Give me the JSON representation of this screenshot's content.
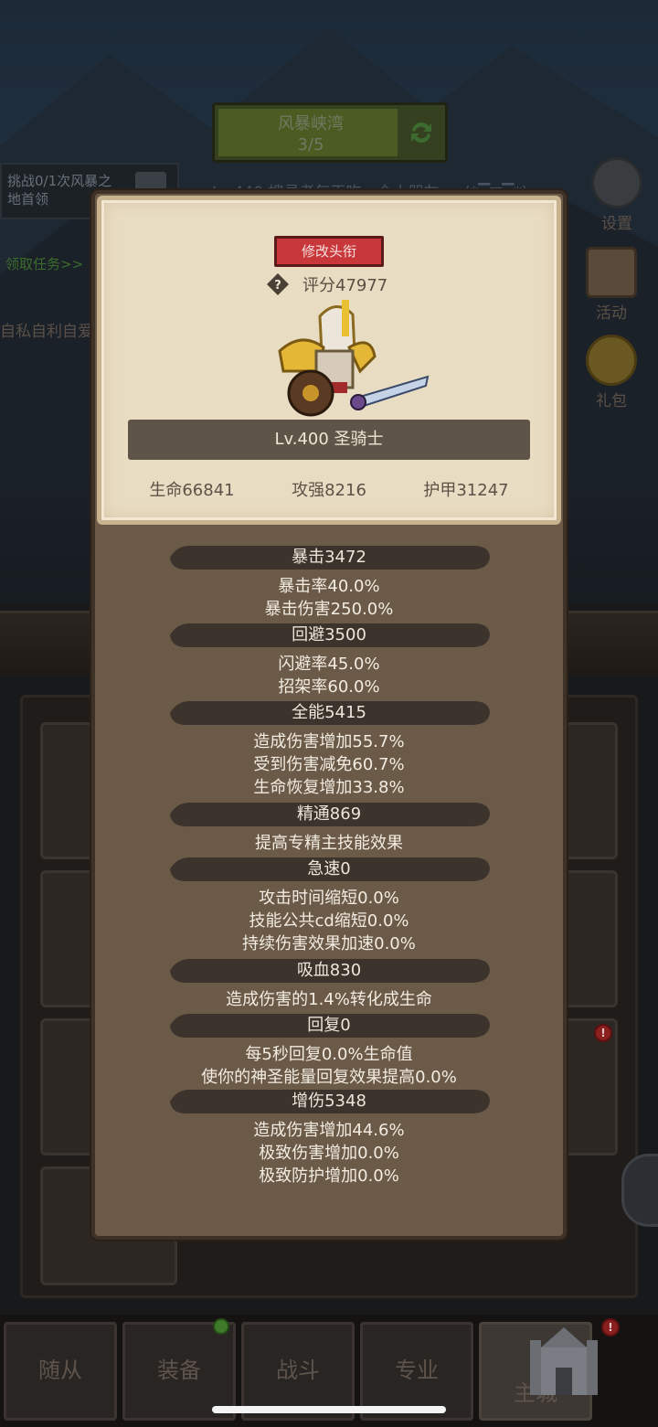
{
  "background": {
    "stage": {
      "name": "风暴峡湾",
      "progress": "3/5"
    },
    "quest": {
      "text": "挑战0/1次风暴之地首领",
      "link": "领取任务>>"
    },
    "chat_line": "自私自利自爱",
    "marquee": "Lv.440 搜寻者每天吃一个小朋友～o(*▔▽▔*)o",
    "side_buttons": [
      {
        "label": "设置",
        "icon": "gear-icon"
      },
      {
        "label": "活动",
        "icon": "scroll-icon"
      },
      {
        "label": "礼包",
        "icon": "gift-pouch-icon"
      }
    ],
    "bottom_nav": [
      "随从",
      "装备",
      "战斗",
      "专业",
      "主城"
    ]
  },
  "modal": {
    "title_button": "修改头衔",
    "score_label": "评分47977",
    "hero_name": "Lv.400 圣骑士",
    "main_stats": {
      "hp": "生命66841",
      "attack": "攻强8216",
      "armor": "护甲31247"
    },
    "sections": [
      {
        "header": "暴击3472",
        "lines": [
          "暴击率40.0%",
          "暴击伤害250.0%"
        ]
      },
      {
        "header": "回避3500",
        "lines": [
          "闪避率45.0%",
          "招架率60.0%"
        ]
      },
      {
        "header": "全能5415",
        "lines": [
          "造成伤害增加55.7%",
          "受到伤害减免60.7%",
          "生命恢复增加33.8%"
        ]
      },
      {
        "header": "精通869",
        "lines": [
          "提高专精主技能效果"
        ]
      },
      {
        "header": "急速0",
        "lines": [
          "攻击时间缩短0.0%",
          "技能公共cd缩短0.0%",
          "持续伤害效果加速0.0%"
        ]
      },
      {
        "header": "吸血830",
        "lines": [
          "造成伤害的1.4%转化成生命"
        ]
      },
      {
        "header": "回复0",
        "lines": [
          "每5秒回复0.0%生命值",
          "使你的神圣能量回复效果提高0.0%"
        ]
      },
      {
        "header": "增伤5348",
        "lines": [
          "造成伤害增加44.6%",
          "极致伤害增加0.0%",
          "极致防护增加0.0%"
        ]
      }
    ]
  },
  "colors": {
    "modal_bg": "#6b5a47",
    "parchment": "#e8dcc2",
    "title_button": "#c8373a",
    "section_bar": "#3b332c"
  }
}
